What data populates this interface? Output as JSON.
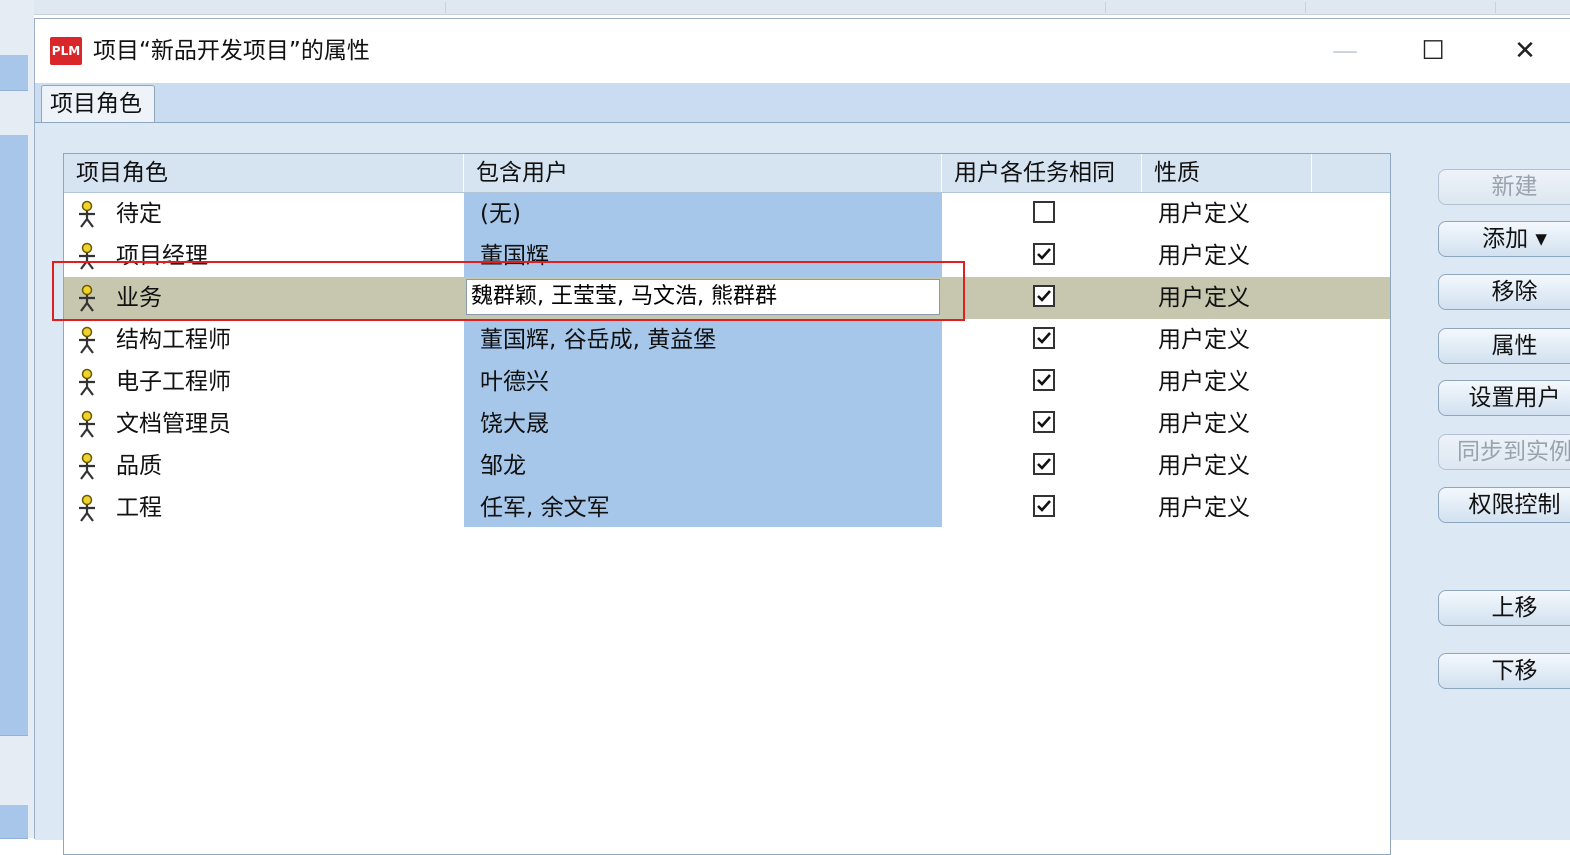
{
  "window": {
    "title": "项目“新品开发项目”的属性",
    "app_icon_text": "PLM",
    "minimize_glyph": "—",
    "maximize_glyph": "☐",
    "close_glyph": "✕"
  },
  "tabs": [
    {
      "label": "项目角色",
      "active": true
    }
  ],
  "table": {
    "columns": [
      "项目角色",
      "包含用户",
      "用户各任务相同",
      "性质"
    ],
    "rows": [
      {
        "role": "待定",
        "users": "(无)",
        "same_for_tasks": false,
        "nature": "用户定义"
      },
      {
        "role": "项目经理",
        "users": "董国辉",
        "same_for_tasks": true,
        "nature": "用户定义"
      },
      {
        "role": "业务",
        "users": "魏群颖, 王莹莹, 马文浩, 熊群群",
        "same_for_tasks": true,
        "nature": "用户定义",
        "selected": true,
        "editing": true
      },
      {
        "role": "结构工程师",
        "users": "董国辉, 谷岳成, 黄益堡",
        "same_for_tasks": true,
        "nature": "用户定义"
      },
      {
        "role": "电子工程师",
        "users": "叶德兴",
        "same_for_tasks": true,
        "nature": "用户定义"
      },
      {
        "role": "文档管理员",
        "users": "饶大晟",
        "same_for_tasks": true,
        "nature": "用户定义"
      },
      {
        "role": "品质",
        "users": "邹龙",
        "same_for_tasks": true,
        "nature": "用户定义"
      },
      {
        "role": "工程",
        "users": "任军, 余文军",
        "same_for_tasks": true,
        "nature": "用户定义"
      }
    ]
  },
  "buttons": {
    "new": "新建",
    "add": "添加 ▾",
    "remove": "移除",
    "properties": "属性",
    "set_users": "设置用户",
    "sync_to_instance": "同步到实例",
    "permission_control": "权限控制",
    "move_up": "上移",
    "move_down": "下移"
  },
  "colors": {
    "selected_row": "#c6c7ae",
    "users_column": "#a6c7ea",
    "highlight_border": "#e02020",
    "app_icon": "#d8262a"
  }
}
